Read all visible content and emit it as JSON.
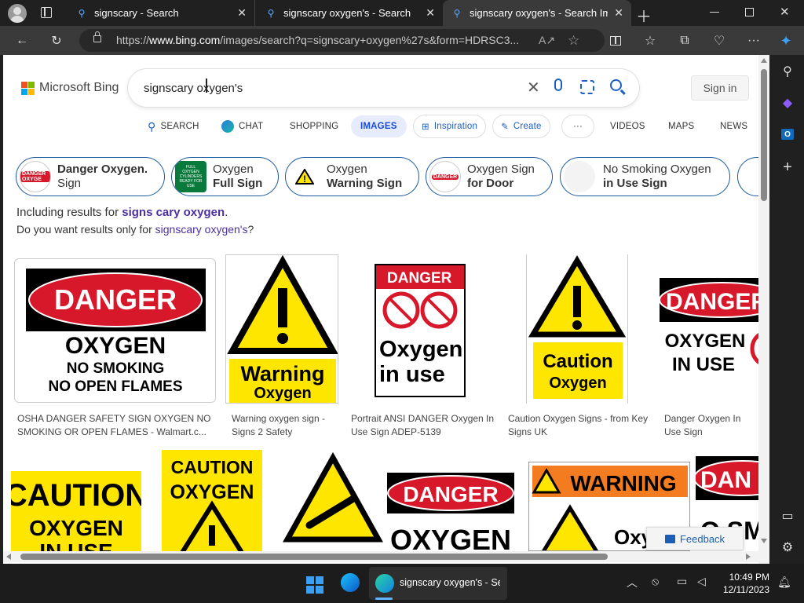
{
  "tabs": [
    {
      "title": "signscary - Search"
    },
    {
      "title": "signscary oxygen's - Search"
    },
    {
      "title": "signscary oxygen's - Search Imag"
    }
  ],
  "address": {
    "prefix": "https://",
    "domain": "www.bing.com",
    "path": "/images/search?q=signscary+oxygen%27s&form=HDRSC3..."
  },
  "bing": {
    "logo_text": "Microsoft Bing",
    "search_value": "signscary oxygen's",
    "signin": "Sign in",
    "nav": [
      "SEARCH",
      "CHAT",
      "SHOPPING",
      "IMAGES",
      "Inspiration",
      "Create",
      "···",
      "VIDEOS",
      "MAPS",
      "NEWS"
    ],
    "chips": [
      {
        "line1": "Danger Oxygen.",
        "line2": "Sign",
        "thumb": "DANGER OXYGE"
      },
      {
        "line1": "Oxygen",
        "line2": "Full Sign",
        "thumb": "FULL OXYGEN CYLINDERS READY FOR USE"
      },
      {
        "line1": "Oxygen",
        "line2": "Warning Sign",
        "thumb": "Warning Oxygen"
      },
      {
        "line1": "Oxygen Sign",
        "line2": "for Door",
        "thumb": "DANGER OXYGEN"
      },
      {
        "line1": "No Smoking Oxygen",
        "line2": "in Use Sign"
      }
    ],
    "including_prefix": "Including results for ",
    "including_term": "signs cary oxygen",
    "including_suffix": ".",
    "dym_prefix": "Do you want results only for ",
    "dym_term": "signscary oxygen's",
    "dym_suffix": "?",
    "row1": [
      {
        "caption": "OSHA DANGER SAFETY SIGN OXYGEN NO SMOKING OR OPEN FLAMES - Walmart.c...",
        "head": "DANGER",
        "l1": "OXYGEN",
        "l2": "NO SMOKING",
        "l3": "NO OPEN FLAMES"
      },
      {
        "caption": "Warning oxygen sign - Signs 2 Safety",
        "l1": "Warning",
        "l2": "Oxygen"
      },
      {
        "caption": "Portrait ANSI DANGER Oxygen In Use Sign ADEP-5139",
        "head": "DANGER",
        "l1": "Oxygen",
        "l2": "in use"
      },
      {
        "caption": "Caution Oxygen Signs - from Key Signs UK",
        "l1": "Caution",
        "l2": "Oxygen"
      },
      {
        "caption": "Danger Oxygen In Use Sign",
        "head": "DANGER",
        "l1": "OXYGEN",
        "l2": "IN USE"
      }
    ],
    "row2": [
      {
        "l1": "CAUTION",
        "l2": "OXYGEN",
        "l3": "IN USE"
      },
      {
        "l1": "CAUTION",
        "l2": "OXYGEN"
      },
      {},
      {
        "head": "DANGER",
        "l1": "OXYGEN"
      },
      {
        "head": "WARNING",
        "l1": "Oxy"
      },
      {
        "head": "DAN",
        "l1": "O SM"
      }
    ],
    "feedback": "Feedback"
  },
  "taskbar": {
    "app_label": "signscary oxygen's - Sea",
    "time": "10:49 PM",
    "date": "12/11/2023"
  },
  "colors": {
    "danger_red": "#d7182a",
    "warning_yellow": "#ffe600",
    "chip_border": "#1c5a9e",
    "link": "#4b2fa0"
  }
}
